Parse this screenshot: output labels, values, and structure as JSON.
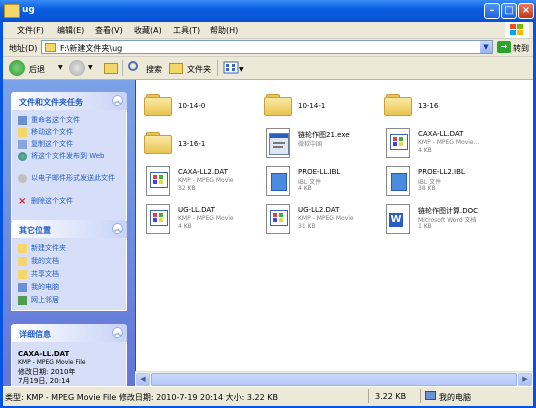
{
  "window": {
    "title": "ug"
  },
  "menu": [
    "文件(F)",
    "编辑(E)",
    "查看(V)",
    "收藏(A)",
    "工具(T)",
    "帮助(H)"
  ],
  "address": {
    "label": "地址(D)",
    "path": "F:\\新建文件夹\\ug",
    "go": "转到"
  },
  "toolbar": {
    "back": "后退",
    "search": "搜索",
    "folders": "文件夹"
  },
  "tasks": {
    "title": "文件和文件夹任务",
    "items": [
      "重命名这个文件",
      "移动这个文件",
      "复制这个文件",
      "将这个文件发布到 Web",
      "以电子邮件形式发送此文件",
      "删除这个文件"
    ]
  },
  "places": {
    "title": "其它位置",
    "items": [
      "新建文件夹",
      "我的文档",
      "共享文档",
      "我的电脑",
      "网上邻居"
    ]
  },
  "details": {
    "title": "详细信息",
    "name": "CAXA-LL.DAT",
    "type": "KMP - MPEG Movie File",
    "modified": "修改日期: 2010年7月19日, 20:14"
  },
  "files": [
    {
      "name": "10-14-0",
      "kind": "folder"
    },
    {
      "name": "10-14-1",
      "kind": "folder"
    },
    {
      "name": "13-16",
      "kind": "folder"
    },
    {
      "name": "13-16-1",
      "kind": "folder"
    },
    {
      "name": "链轮作图21.exe",
      "type": "微软中国",
      "kind": "exe"
    },
    {
      "name": "CAXA-LL.DAT",
      "type": "KMP - MPEG Movie...",
      "size": "4 KB",
      "kind": "movie"
    },
    {
      "name": "CAXA-LL2.DAT",
      "type": "KMP - MPEG Movie",
      "size": "32 KB",
      "kind": "movie"
    },
    {
      "name": "PROE-LL.IBL",
      "type": "IBL 文件",
      "size": "4 KB",
      "kind": "ibl"
    },
    {
      "name": "PROE-LL2.IBL",
      "type": "IBL 文件",
      "size": "38 KB",
      "kind": "ibl"
    },
    {
      "name": "UG-LL.DAT",
      "type": "KMP - MPEG Movie",
      "size": "4 KB",
      "kind": "movie"
    },
    {
      "name": "UG-LL2.DAT",
      "type": "KMP - MPEG Movie",
      "size": "31 KB",
      "kind": "movie"
    },
    {
      "name": "链轮作图计算.DOC",
      "type": "Microsoft Word 文档",
      "size": "1 KB",
      "kind": "doc"
    }
  ],
  "status": {
    "text": "类型: KMP - MPEG Movie File 修改日期: 2010-7-19 20:14 大小: 3.22 KB",
    "size": "3.22 KB",
    "location": "我的电脑"
  },
  "colors": {
    "titlebar": "#0a5fe0",
    "taskpane": "#6375d6",
    "link": "#215dc6"
  }
}
